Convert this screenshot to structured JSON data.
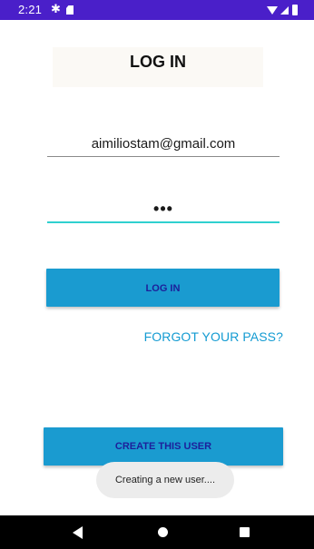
{
  "status_bar": {
    "time": "2:21",
    "icons": [
      "gear-icon",
      "sd-card-icon",
      "wifi-icon",
      "signal-icon",
      "battery-icon"
    ],
    "background": "#4a1fc9"
  },
  "header": {
    "title": "LOG IN"
  },
  "form": {
    "email_value": "aimiliostam@gmail.com",
    "password_value": "•••",
    "login_button_label": "LOG IN",
    "forgot_link_label": "FORGOT YOUR PASS?",
    "create_user_button_label": "CREATE THIS USER"
  },
  "toast": {
    "message": "Creating a new user...."
  },
  "nav_bar": {
    "icons": [
      "back-icon",
      "home-icon",
      "recents-icon"
    ]
  },
  "colors": {
    "accent": "#1a9bd0",
    "button_text": "#1d1f9a",
    "link": "#139bd2",
    "focus_underline": "#2fd0cf"
  }
}
